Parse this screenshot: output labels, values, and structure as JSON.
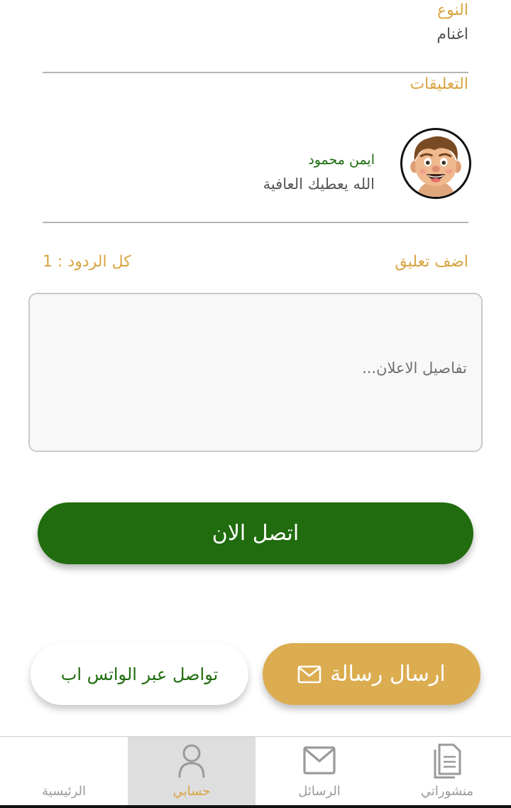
{
  "details": {
    "type_label": "النوع",
    "type_value": "اغنام"
  },
  "comments": {
    "title": "التعليقات",
    "items": [
      {
        "author": "ايمن محمود",
        "text": "الله يعطيك العافية"
      }
    ]
  },
  "add_comment": {
    "label": "اضف تعليق",
    "replies_label": "كل الردود :",
    "replies_count": "1",
    "placeholder": "تفاصيل الاعلان..."
  },
  "actions": {
    "call_now": "اتصل الان",
    "send_message": "ارسال رسالة",
    "whatsapp": "تواصل عبر الواتس اب"
  },
  "bottom_nav": {
    "items": [
      {
        "label": "الرئيسية",
        "icon": "home-icon",
        "active": false
      },
      {
        "label": "حسابي",
        "icon": "user-icon",
        "active": true
      },
      {
        "label": "الرسائل",
        "icon": "mail-icon",
        "active": false
      },
      {
        "label": "منشوراتي",
        "icon": "document-icon",
        "active": false
      }
    ]
  },
  "colors": {
    "accent_gold": "#d9a441",
    "primary_green": "#206c0e",
    "name_green": "#1e6b10",
    "message_button": "#dcac50"
  }
}
